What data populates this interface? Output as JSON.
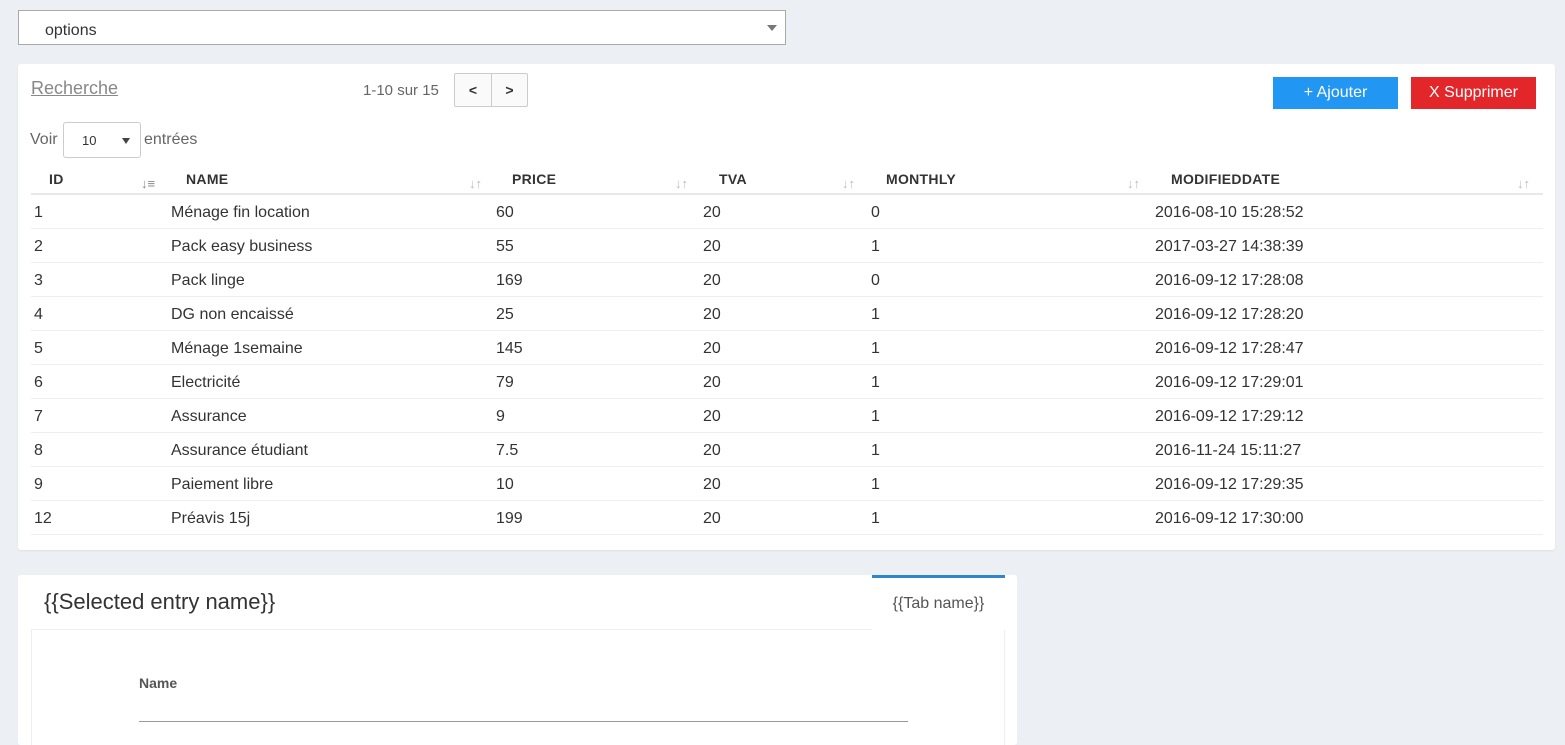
{
  "top_select": {
    "value": "options"
  },
  "toolbar": {
    "search_label": "Recherche",
    "pager_info": "1-10 sur 15",
    "prev_label": "<",
    "next_label": ">",
    "add_label": "+ Ajouter",
    "delete_label": "X Supprimer",
    "add_color": "#2196f3",
    "delete_color": "#e3262a"
  },
  "length": {
    "show_label": "Voir",
    "value": "10",
    "suffix": "entrées"
  },
  "table": {
    "columns": [
      "ID",
      "NAME",
      "PRICE",
      "TVA",
      "MONTHLY",
      "MODIFIEDDATE"
    ],
    "sort_icon": "sort-icon",
    "rows": [
      [
        "1",
        "Ménage fin location",
        "60",
        "20",
        "0",
        "2016-08-10 15:28:52"
      ],
      [
        "2",
        "Pack easy business",
        "55",
        "20",
        "1",
        "2017-03-27 14:38:39"
      ],
      [
        "3",
        "Pack linge",
        "169",
        "20",
        "0",
        "2016-09-12 17:28:08"
      ],
      [
        "4",
        "DG non encaissé",
        "25",
        "20",
        "1",
        "2016-09-12 17:28:20"
      ],
      [
        "5",
        "Ménage 1semaine",
        "145",
        "20",
        "1",
        "2016-09-12 17:28:47"
      ],
      [
        "6",
        "Electricité",
        "79",
        "20",
        "1",
        "2016-09-12 17:29:01"
      ],
      [
        "7",
        "Assurance",
        "9",
        "20",
        "1",
        "2016-09-12 17:29:12"
      ],
      [
        "8",
        "Assurance étudiant",
        "7.5",
        "20",
        "1",
        "2016-11-24 15:11:27"
      ],
      [
        "9",
        "Paiement libre",
        "10",
        "20",
        "1",
        "2016-09-12 17:29:35"
      ],
      [
        "12",
        "Préavis 15j",
        "199",
        "20",
        "1",
        "2016-09-12 17:30:00"
      ]
    ]
  },
  "detail": {
    "title": "{{Selected entry name}}",
    "tab_label": "{{Tab name}}",
    "tab_accent": "#2f86c8",
    "field_label": "Name",
    "field_value": ""
  }
}
